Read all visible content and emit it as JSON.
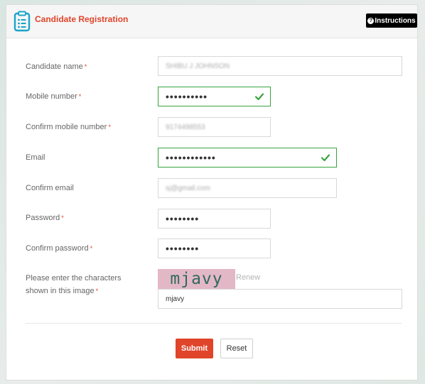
{
  "header": {
    "title": "Candidate Registration",
    "instructions_label": "Instructions",
    "instructions_icon": "?"
  },
  "form": {
    "required_mark": "*",
    "candidate_name": {
      "label": "Candidate name",
      "value": "SHIBU J JOHNSON"
    },
    "mobile_number": {
      "label": "Mobile number",
      "value": "••••••••••"
    },
    "confirm_mobile": {
      "label": "Confirm mobile number",
      "value": "9174498553"
    },
    "email": {
      "label": "Email",
      "value": "••••••••••••"
    },
    "confirm_email": {
      "label": "Confirm email",
      "value": "sj@gmail.com"
    },
    "password": {
      "label": "Password",
      "value": "••••••••"
    },
    "confirm_password": {
      "label": "Confirm password",
      "value": "••••••••"
    },
    "captcha": {
      "label_line1": "Please enter the characters",
      "label_line2": "shown in this image",
      "image_text": "mjavy",
      "renew_label": "Renew",
      "value": "mjavy"
    }
  },
  "buttons": {
    "submit": "Submit",
    "reset": "Reset"
  },
  "colors": {
    "accent": "#e0442a",
    "valid": "#37a33f",
    "icon": "#1aa3c9"
  }
}
